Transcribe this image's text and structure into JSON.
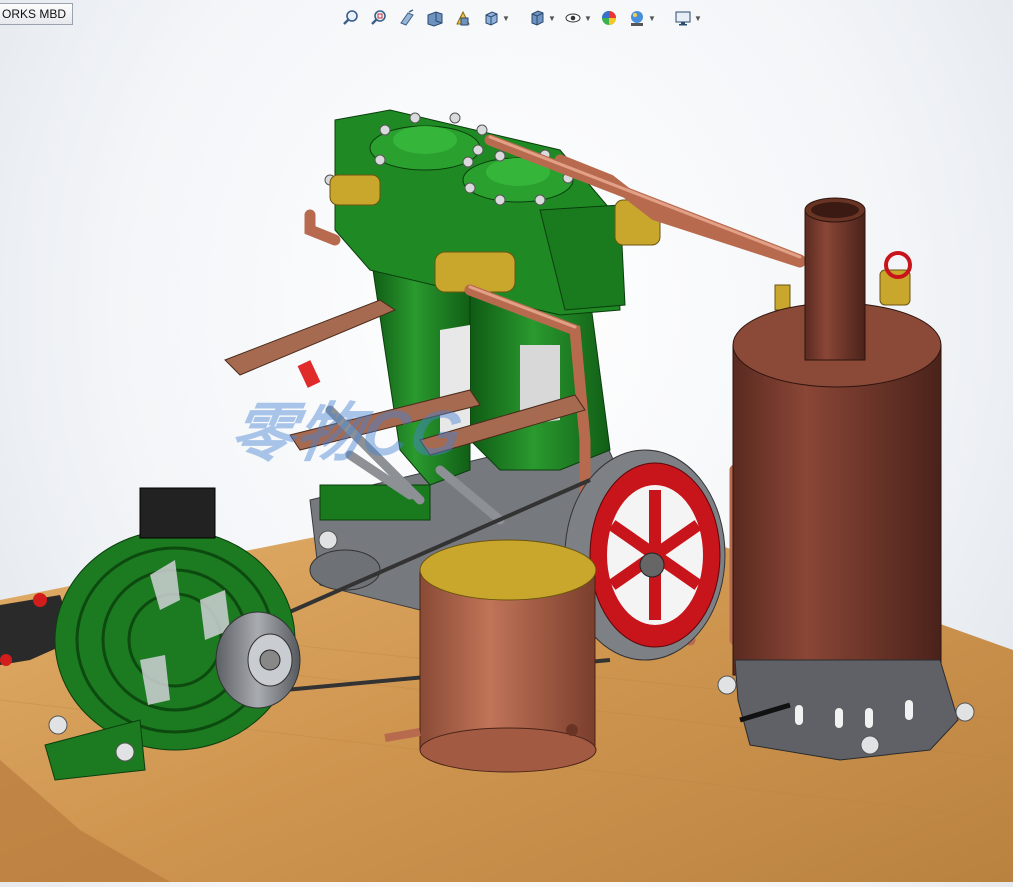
{
  "tab": {
    "label": "ORKS MBD"
  },
  "heads_up_toolbar": {
    "buttons": [
      {
        "icon": "zoom-to-fit-icon"
      },
      {
        "icon": "zoom-to-area-icon"
      },
      {
        "icon": "previous-view-icon"
      },
      {
        "icon": "section-view-icon"
      },
      {
        "icon": "dynamic-annotation-views-icon"
      },
      {
        "icon": "view-orientation-icon",
        "dropdown": true
      },
      {
        "icon": "display-style-icon",
        "dropdown": true
      },
      {
        "icon": "hide-show-items-icon",
        "dropdown": true
      },
      {
        "icon": "edit-appearance-icon"
      },
      {
        "icon": "apply-scene-icon",
        "dropdown": true
      },
      {
        "icon": "view-settings-icon",
        "dropdown": true
      }
    ]
  },
  "watermark": {
    "text": "零物CG"
  },
  "colors": {
    "engine_green": "#1f8a23",
    "copper": "#b86a4e",
    "boiler": "#7a3a2c",
    "flywheel_red": "#c8141b",
    "brass": "#c9a62c",
    "wood": "#d9a35a",
    "steel": "#8a8d93"
  }
}
